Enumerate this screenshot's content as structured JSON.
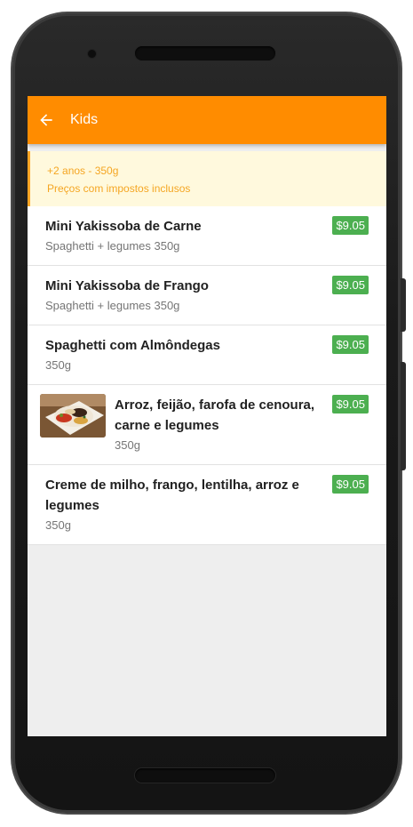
{
  "app": {
    "title": "Kids"
  },
  "icons": {
    "back": "arrow-back-icon",
    "thumb": "food-plate-image"
  },
  "colors": {
    "appbar": "#ff8c00",
    "price_badge": "#4caf50",
    "notice_bg": "#fff9dd",
    "notice_text": "#f5a623"
  },
  "notice": {
    "line1": "+2 anos - 350g",
    "line2": "Preços com impostos inclusos"
  },
  "items": [
    {
      "name": "Mini Yakissoba de Carne",
      "desc": "Spaghetti + legumes 350g",
      "price": "$9.05"
    },
    {
      "name": "Mini Yakissoba de Frango",
      "desc": "Spaghetti + legumes 350g",
      "price": "$9.05"
    },
    {
      "name": "Spaghetti com Almôndegas",
      "desc": "350g",
      "price": "$9.05"
    },
    {
      "name": "Arroz, feijão, farofa de cenoura, carne e legumes",
      "desc": "350g",
      "price": "$9.05"
    },
    {
      "name": "Creme de milho, frango, lentilha, arroz e legumes",
      "desc": "350g",
      "price": "$9.05"
    }
  ]
}
